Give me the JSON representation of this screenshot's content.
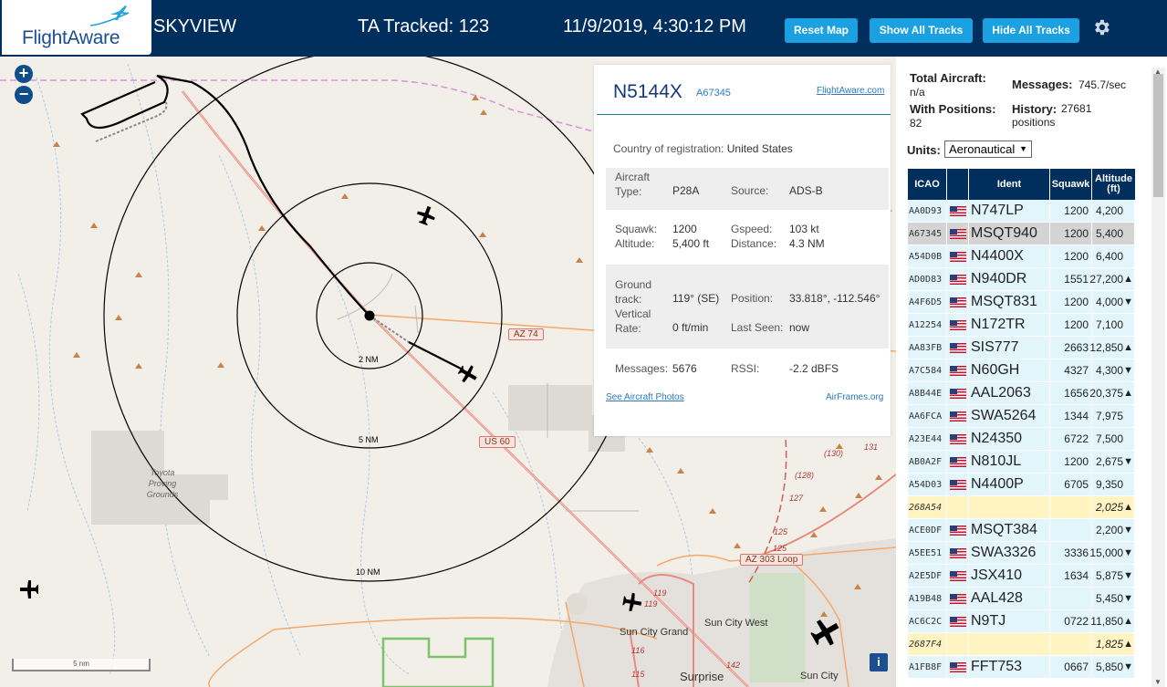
{
  "header": {
    "brand": "FlightAware",
    "app_name": "SKYVIEW",
    "tracked": "TA Tracked: 123",
    "datetime": "11/9/2019, 4:30:12 PM",
    "buttons": {
      "reset_map": "Reset Map",
      "show_all": "Show All Tracks",
      "hide_all": "Hide All Tracks"
    }
  },
  "map": {
    "zoom_in": "+",
    "zoom_out": "−",
    "range_rings": [
      "2 NM",
      "5 NM",
      "10 NM"
    ],
    "road_labels": [
      "AZ 74",
      "US 60",
      "AZ 303 Loop"
    ],
    "places": [
      "Toyota Proving Grounds",
      "Sun City Grand",
      "Sun City West",
      "Surprise",
      "Sun City"
    ],
    "hwy_numbers": [
      "(130)",
      "131",
      "(128)",
      "127",
      "125",
      "125",
      "119",
      "119",
      "116",
      "115",
      "142"
    ],
    "scale": "5 nm",
    "info": "i"
  },
  "popup": {
    "callsign": "N5144X",
    "icao": "A67345",
    "fa_link": "FlightAware.com",
    "country_label": "Country of registration:",
    "country": "United States",
    "aircraft_type_label": "Aircraft Type:",
    "aircraft_type": "P28A",
    "source_label": "Source:",
    "source": "ADS-B",
    "squawk_label": "Squawk:",
    "squawk": "1200",
    "altitude_label": "Altitude:",
    "altitude": "5,400 ft",
    "gspeed_label": "Gspeed:",
    "gspeed": "103 kt",
    "distance_label": "Distance:",
    "distance": "4.3 NM",
    "ground_track_label": "Ground track:",
    "ground_track": "119° (SE)",
    "position_label": "Position:",
    "position": "33.818°, -112.546°",
    "vertical_rate_label": "Vertical Rate:",
    "vertical_rate": "0 ft/min",
    "last_seen_label": "Last Seen:",
    "last_seen": "now",
    "messages_label": "Messages:",
    "messages": "5676",
    "rssi_label": "RSSI:",
    "rssi": "-2.2 dBFS",
    "photos_link": "See Aircraft Photos",
    "airframes_link": "AirFrames.org"
  },
  "sidebar": {
    "total_aircraft_label": "Total Aircraft:",
    "total_aircraft": "n/a",
    "with_positions_label": "With Positions:",
    "with_positions": "82",
    "messages_label": "Messages:",
    "messages": "745.7/sec",
    "history_label": "History:",
    "history": "27681 positions",
    "units_label": "Units:",
    "units_value": "Aeronautical",
    "columns": [
      "ICAO",
      "",
      "Ident",
      "Squawk",
      "Altitude (ft)"
    ],
    "rows": [
      {
        "icao": "AA0D93",
        "ident": "N747LP",
        "squawk": "1200",
        "alt": "4,200",
        "trend": ""
      },
      {
        "icao": "A67345",
        "ident": "MSQT940",
        "squawk": "1200",
        "alt": "5,400",
        "trend": "",
        "selected": true
      },
      {
        "icao": "A54D0B",
        "ident": "N4400X",
        "squawk": "1200",
        "alt": "6,400",
        "trend": ""
      },
      {
        "icao": "AD0D83",
        "ident": "N940DR",
        "squawk": "1551",
        "alt": "27,200",
        "trend": "▲"
      },
      {
        "icao": "A4F6D5",
        "ident": "MSQT831",
        "squawk": "1200",
        "alt": "4,000",
        "trend": "▼"
      },
      {
        "icao": "A12254",
        "ident": "N172TR",
        "squawk": "1200",
        "alt": "7,100",
        "trend": ""
      },
      {
        "icao": "AA83FB",
        "ident": "SIS777",
        "squawk": "2663",
        "alt": "12,850",
        "trend": "▲"
      },
      {
        "icao": "A7C584",
        "ident": "N60GH",
        "squawk": "4327",
        "alt": "4,300",
        "trend": "▼"
      },
      {
        "icao": "A8B44E",
        "ident": "AAL2063",
        "squawk": "1656",
        "alt": "20,375",
        "trend": "▲"
      },
      {
        "icao": "AA6FCA",
        "ident": "SWA5264",
        "squawk": "1344",
        "alt": "7,975",
        "trend": ""
      },
      {
        "icao": "A23E44",
        "ident": "N24350",
        "squawk": "6722",
        "alt": "7,500",
        "trend": ""
      },
      {
        "icao": "AB0A2F",
        "ident": "N810JL",
        "squawk": "1200",
        "alt": "2,675",
        "trend": "▼"
      },
      {
        "icao": "A54D03",
        "ident": "N4400P",
        "squawk": "6705",
        "alt": "9,350",
        "trend": ""
      },
      {
        "icao": "268A54",
        "ident": "",
        "squawk": "",
        "alt": "2,025",
        "trend": "▲",
        "warn": true,
        "noflag": true
      },
      {
        "icao": "ACE0DF",
        "ident": "MSQT384",
        "squawk": "",
        "alt": "2,200",
        "trend": "▼"
      },
      {
        "icao": "A5EE51",
        "ident": "SWA3326",
        "squawk": "3336",
        "alt": "15,000",
        "trend": "▼"
      },
      {
        "icao": "A2E5DF",
        "ident": "JSX410",
        "squawk": "1634",
        "alt": "5,875",
        "trend": "▼"
      },
      {
        "icao": "A19B48",
        "ident": "AAL428",
        "squawk": "",
        "alt": "5,450",
        "trend": "▼"
      },
      {
        "icao": "AC6C2C",
        "ident": "N9TJ",
        "squawk": "0722",
        "alt": "11,850",
        "trend": "▲"
      },
      {
        "icao": "2687F4",
        "ident": "",
        "squawk": "",
        "alt": "1,825",
        "trend": "▲",
        "warn": true,
        "noflag": true
      },
      {
        "icao": "A1FB8F",
        "ident": "FFT753",
        "squawk": "0667",
        "alt": "5,850",
        "trend": "▼"
      }
    ]
  },
  "colors": {
    "header_bg": "#002f5d",
    "button": "#1ba1e2",
    "row_bg": "#e1f5fb",
    "warn_bg": "#fff4c2"
  }
}
